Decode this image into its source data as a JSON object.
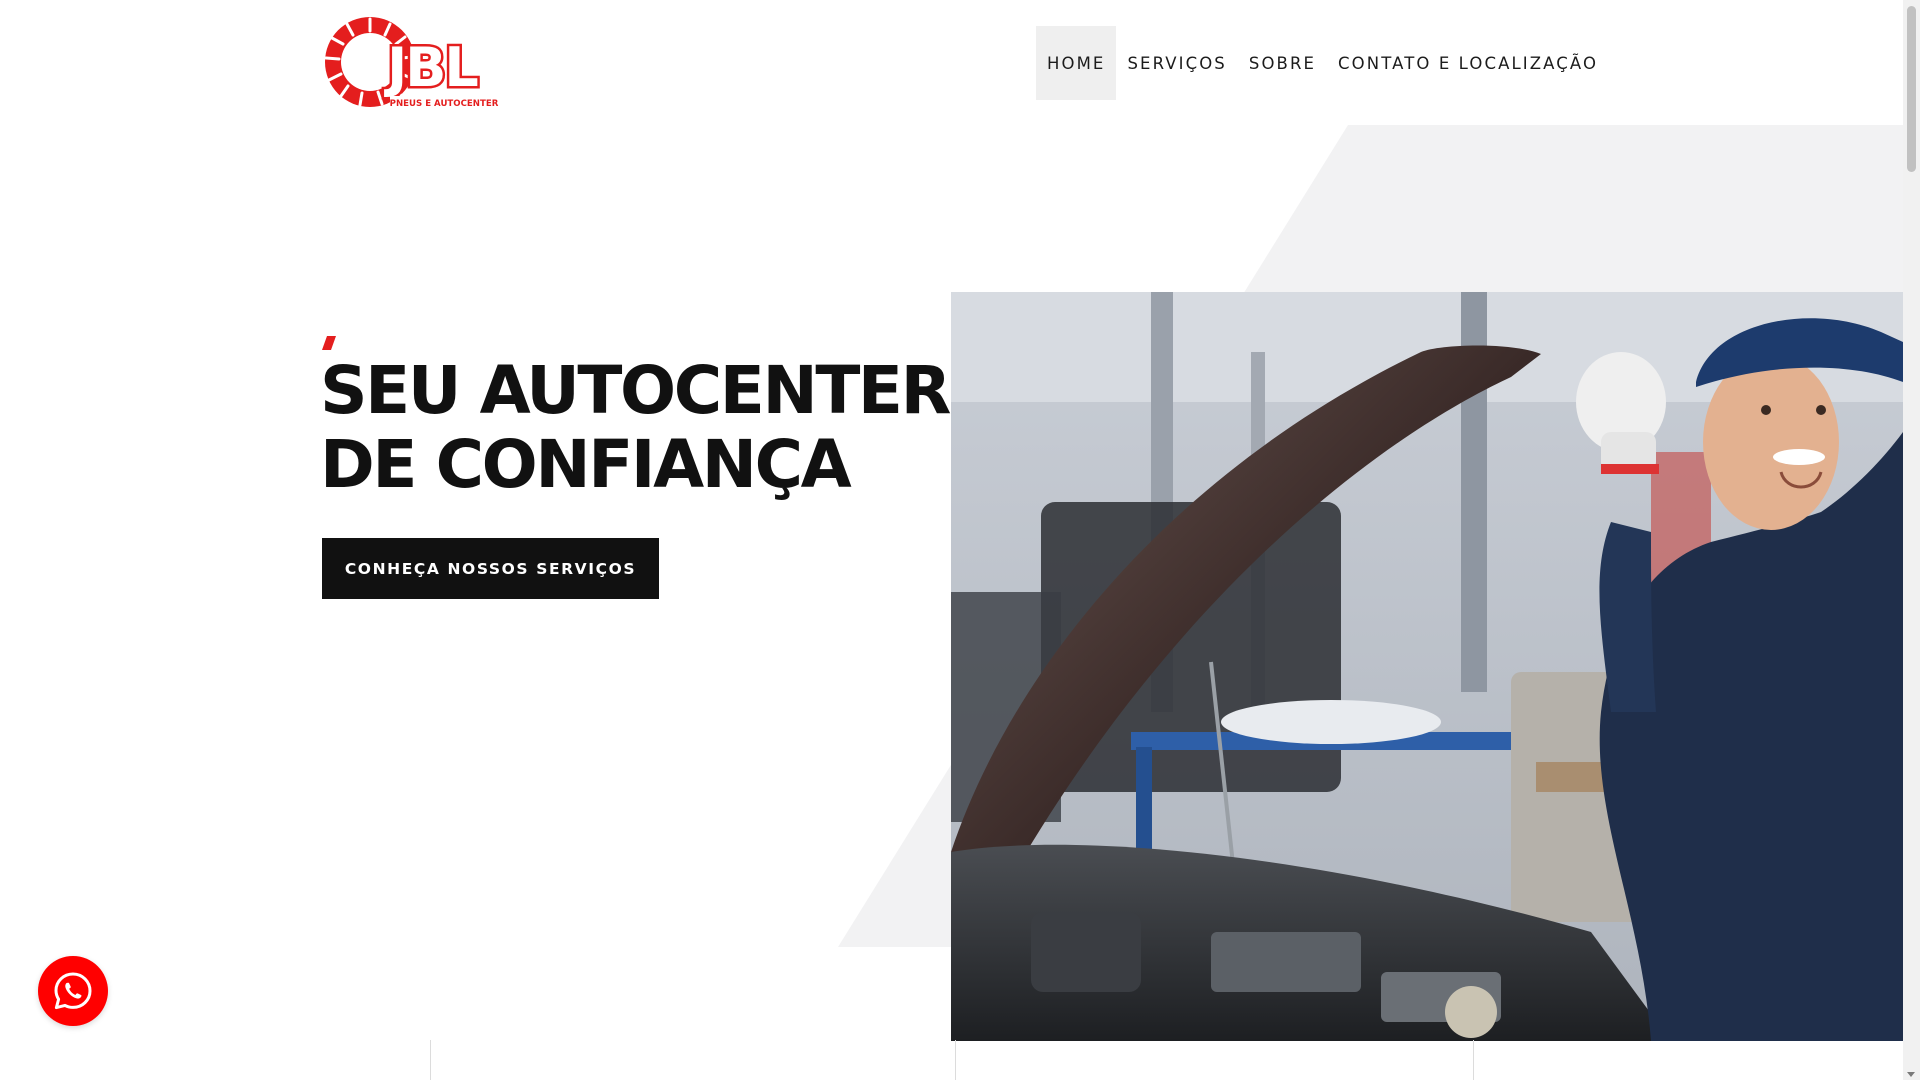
{
  "brand": {
    "name": "JBL",
    "tagline": "PNEUS E AUTOCENTER",
    "logo_color": "#e41e1e"
  },
  "nav": {
    "items": [
      {
        "label": "HOME",
        "active": true
      },
      {
        "label": "SERVIÇOS",
        "active": false
      },
      {
        "label": "SOBRE",
        "active": false
      },
      {
        "label": "CONTATO E LOCALIZAÇÃO",
        "active": false
      }
    ]
  },
  "hero": {
    "title_line1": "SEU AUTOCENTER",
    "title_line2": "DE CONFIANÇA",
    "cta_label": "CONHEÇA NOSSOS SERVIÇOS",
    "image_icon": "mechanic-photo"
  },
  "floating": {
    "whatsapp_icon": "whatsapp-icon",
    "color": "#ff0000"
  },
  "colors": {
    "accent": "#e41e1e",
    "dark": "#111111",
    "backdrop": "#f2f2f3"
  }
}
